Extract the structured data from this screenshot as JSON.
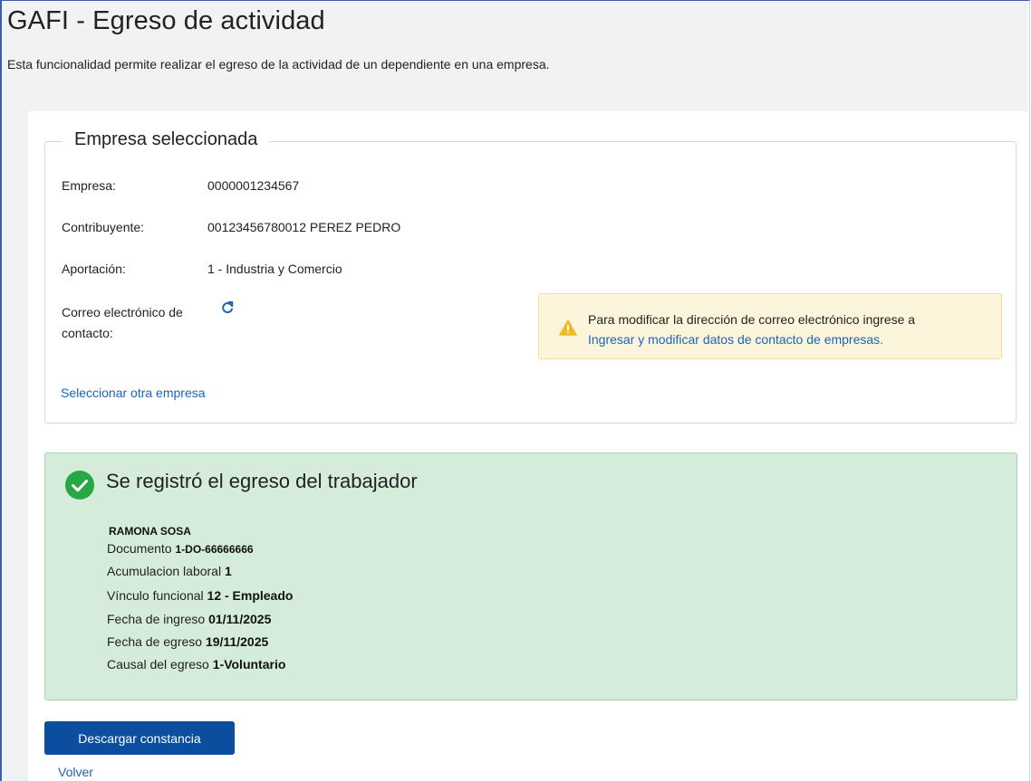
{
  "page": {
    "title": "GAFI - Egreso de actividad",
    "subtitle": "Esta funcionalidad permite realizar el egreso de la actividad de un dependiente en una empresa."
  },
  "empresa_section": {
    "legend": "Empresa seleccionada",
    "rows": [
      {
        "label": "Empresa:",
        "value": "0000001234567"
      },
      {
        "label": "Contribuyente:",
        "value": "00123456780012 PEREZ PEDRO"
      },
      {
        "label": "Aportación:",
        "value": "1 - Industria y Comercio"
      }
    ],
    "email_label_line1": "Correo electrónico de",
    "email_label_line2": "contacto:",
    "refresh_icon": "refresh-icon",
    "warning": {
      "icon": "warning-icon",
      "text": "Para modificar la dirección de correo electrónico ingrese a",
      "link": "Ingresar y modificar datos de contacto de empresas."
    },
    "select_other_link": "Seleccionar otra empresa"
  },
  "success": {
    "icon": "check-circle-icon",
    "title": "Se registró el egreso del trabajador",
    "worker_name": "RAMONA SOSA",
    "details": [
      {
        "label": "Documento",
        "value": "1-DO-66666666"
      },
      {
        "label": "Acumulacion laboral",
        "value": "1"
      },
      {
        "label": "Vínculo funcional",
        "value": "12 - Empleado"
      },
      {
        "label": "Fecha de ingreso",
        "value": "01/11/2025"
      },
      {
        "label": "Fecha de egreso",
        "value": "19/11/2025"
      },
      {
        "label": "Causal del egreso",
        "value": "1-Voluntario"
      }
    ]
  },
  "actions": {
    "download_label": "Descargar constancia",
    "back_label": "Volver"
  },
  "colors": {
    "primary": "#0b4e9f",
    "link": "#1c63b7",
    "success_bg": "#d4ecd9",
    "success_icon": "#28a745",
    "warning_bg": "#fdf5db",
    "warning_icon": "#f0b929"
  }
}
